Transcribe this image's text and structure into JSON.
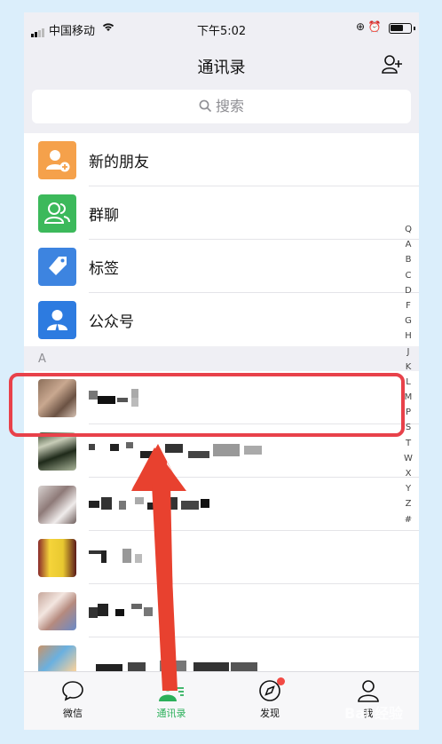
{
  "status_bar": {
    "carrier": "中国移动",
    "time": "下午5:02"
  },
  "nav": {
    "title": "通讯录"
  },
  "search": {
    "placeholder": "搜索"
  },
  "shortcuts": [
    {
      "label": "新的朋友",
      "icon": "add-friend-icon",
      "color": "#f5a14b"
    },
    {
      "label": "群聊",
      "icon": "group-chat-icon",
      "color": "#3cb95b"
    },
    {
      "label": "标签",
      "icon": "tag-icon",
      "color": "#3d84e0"
    },
    {
      "label": "公众号",
      "icon": "official-account-icon",
      "color": "#2d7be0"
    }
  ],
  "section_letter": "A",
  "index_letters": [
    "Q",
    "A",
    "B",
    "C",
    "D",
    "F",
    "G",
    "H",
    "J",
    "K",
    "L",
    "M",
    "P",
    "S",
    "T",
    "W",
    "X",
    "Y",
    "Z",
    "#"
  ],
  "tabs": [
    {
      "label": "微信",
      "icon": "chat-bubble-icon",
      "active": false
    },
    {
      "label": "通讯录",
      "icon": "contacts-icon",
      "active": true
    },
    {
      "label": "发现",
      "icon": "compass-icon",
      "active": false
    },
    {
      "label": "我",
      "icon": "person-icon",
      "active": false
    }
  ],
  "colors": {
    "accent_green": "#2bb05a",
    "highlight_red": "#e8414a",
    "badge_red": "#f24a44"
  },
  "watermark": "Bai 经验"
}
